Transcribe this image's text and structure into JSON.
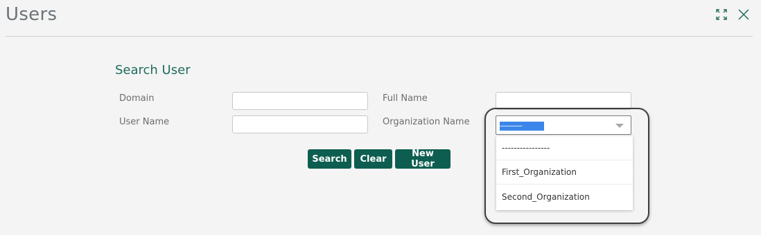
{
  "window": {
    "title": "Users",
    "icons": [
      "expand-icon",
      "close-icon"
    ]
  },
  "form": {
    "section_title": "Search User",
    "labels": {
      "domain": "Domain",
      "user_name": "User Name",
      "full_name": "Full Name",
      "organization_name": "Organization Name"
    },
    "values": {
      "domain": "",
      "user_name": "",
      "full_name": ""
    },
    "organization_select": {
      "selected": "----------------",
      "options": [
        "----------------",
        "First_Organization",
        "Second_Organization"
      ]
    }
  },
  "buttons": {
    "search": "Search",
    "clear": "Clear",
    "new_user": "New User"
  },
  "colors": {
    "accent": "#0d5e50",
    "section_title": "#1f6b5c",
    "selection": "#3b86e8"
  }
}
